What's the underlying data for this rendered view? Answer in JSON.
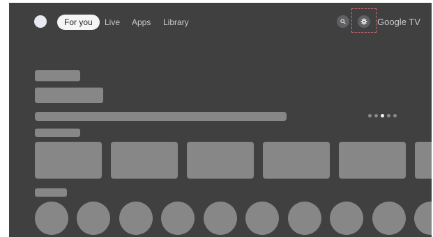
{
  "nav": {
    "tabs": [
      {
        "label": "For you",
        "active": true
      },
      {
        "label": "Live",
        "active": false
      },
      {
        "label": "Apps",
        "active": false
      },
      {
        "label": "Library",
        "active": false
      }
    ],
    "brand": "Google TV",
    "icons": {
      "profile": "avatar",
      "search": "search-icon",
      "settings": "gear-icon"
    }
  },
  "hero": {
    "carousel_pages": 5,
    "active_page": 3
  },
  "rows": [
    {
      "type": "cards",
      "item_count": 6
    },
    {
      "type": "circles",
      "item_count": 10
    }
  ],
  "colors": {
    "background": "#404041",
    "placeholder": "#878787",
    "active_tab_bg": "#f5f5f5",
    "focus_outline": "#e06b78"
  }
}
